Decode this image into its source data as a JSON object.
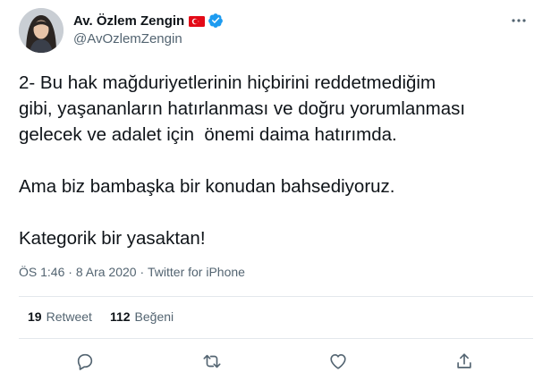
{
  "header": {
    "display_name": "Av. Özlem Zengin",
    "handle": "@AvOzlemZengin",
    "flag_icon": "turkey-flag-icon",
    "verified_icon": "verified-badge-icon",
    "more_icon": "more-options-icon",
    "colors": {
      "verified": "#1d9bf0",
      "flag": "#e30a17"
    }
  },
  "tweet": {
    "text": "2- Bu hak mağduriyetlerinin hiçbirini reddetmediğim\ngibi, yaşananların hatırlanması ve doğru yorumlanması\ngelecek ve adalet için  önemi daima hatırımda.\n\nAma biz bambaşka bir konudan bahsediyoruz.\n\nKategorik bir yasaktan!"
  },
  "meta": {
    "time": "ÖS 1:46",
    "separator": " · ",
    "date": "8 Ara 2020",
    "source": "Twitter for iPhone"
  },
  "stats": {
    "retweets_count": "19",
    "retweets_label": "Retweet",
    "likes_count": "112",
    "likes_label": "Beğeni"
  },
  "actions": {
    "reply_icon": "reply-icon",
    "retweet_icon": "retweet-icon",
    "like_icon": "like-icon",
    "share_icon": "share-icon",
    "icon_color": "#536471"
  }
}
